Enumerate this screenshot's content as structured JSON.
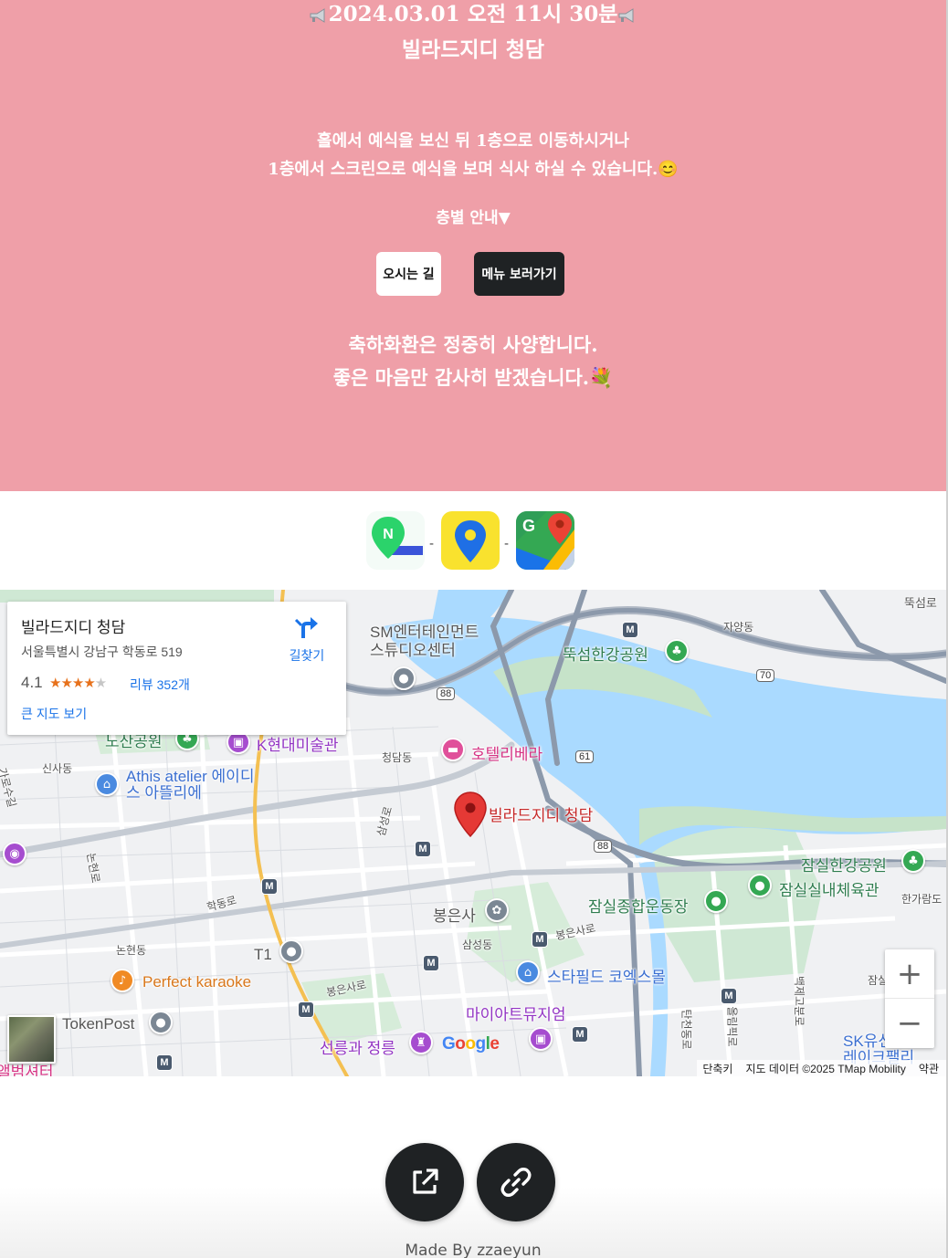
{
  "hero": {
    "date_line": "2024.03.01 오전 11시 30분",
    "venue": "빌라드지디 청담",
    "guide_line1": "홀에서 예식을 보신 뒤 1층으로 이동하시거나",
    "guide_line2": "1층에서 스크린으로 예식을 보며 식사 하실 수 있습니다.😊",
    "floor_toggle": "층별 안내▼",
    "btn_directions": "오시는 길",
    "btn_menu": "메뉴 보러가기",
    "flower_line1": "축하화환은 정중히 사양합니다.",
    "flower_line2": "좋은 마음만 감사히 받겠습니다.💐",
    "bg_color": "#ef9fa8"
  },
  "map_apps": {
    "icons": [
      "naver-map-icon",
      "kakao-map-icon",
      "google-maps-icon"
    ],
    "separator": "-"
  },
  "map": {
    "card": {
      "title": "빌라드지디 청담",
      "address": "서울특별시 강남구 학동로 519",
      "rating": "4.1",
      "stars": "★★★★★",
      "rating_value": 4.1,
      "reviews": "리뷰 352개",
      "big_map": "큰 지도 보기",
      "directions": "길찾기"
    },
    "labels": {
      "sm_ent": "SM엔터테인먼트",
      "sm_ent2": "스튜디오센터",
      "ttukseom_park": "뚝섬한강공원",
      "jayang": "자양동",
      "ttukseom_ro": "뚝섬로",
      "nosan_park": "노산공원",
      "k_museum": "K현대미술관",
      "cheongdam": "청담동",
      "hotel": "호텔리베라",
      "sinsa": "신사동",
      "athis": "Athis atelier 에이디",
      "athis2": "스 아뜰리에",
      "venue_pin": "빌라드지디 청담",
      "samseong_ro": "삼성로",
      "nonhyeon_ro": "논현로",
      "garosu": "가로수길",
      "hakdong_ro": "학동로",
      "bongeunsa": "봉은사",
      "jamsil_sports": "잠실종합운동장",
      "jamsil_indoor": "잠실실내체육관",
      "jamsil_park": "잠실한강공원",
      "hangaram": "한가람도",
      "samseong_dong": "삼성동",
      "bongeunsa_ro": "봉은사로",
      "nonhyeon_dong": "논현동",
      "t1": "T1",
      "karaoke": "Perfect karaoke",
      "starfield": "스타필드 코엑스몰",
      "bongeunsa_ro2": "봉은사로",
      "my_art": "마이아트뮤지엄",
      "tokenpost": "TokenPost",
      "seolleung": "선릉과 정릉",
      "tancheon": "탄천동로",
      "olympic": "올림픽로",
      "baekje": "백제고분로",
      "jamsil_dong": "잠실동",
      "sk": "SK유선",
      "lake": "레이크팰리",
      "album": "앨범셔터",
      "route88": "88",
      "route70": "70",
      "route61": "61"
    },
    "google_logo": "Google",
    "attribution": {
      "shortcuts": "단축키",
      "data": "지도 데이터 ©2025 TMap Mobility",
      "terms": "약관"
    },
    "zoom_in": "+",
    "zoom_out": "−",
    "metro_symbol": "M"
  },
  "footer": {
    "made_by": "Made By zzaeyun"
  }
}
